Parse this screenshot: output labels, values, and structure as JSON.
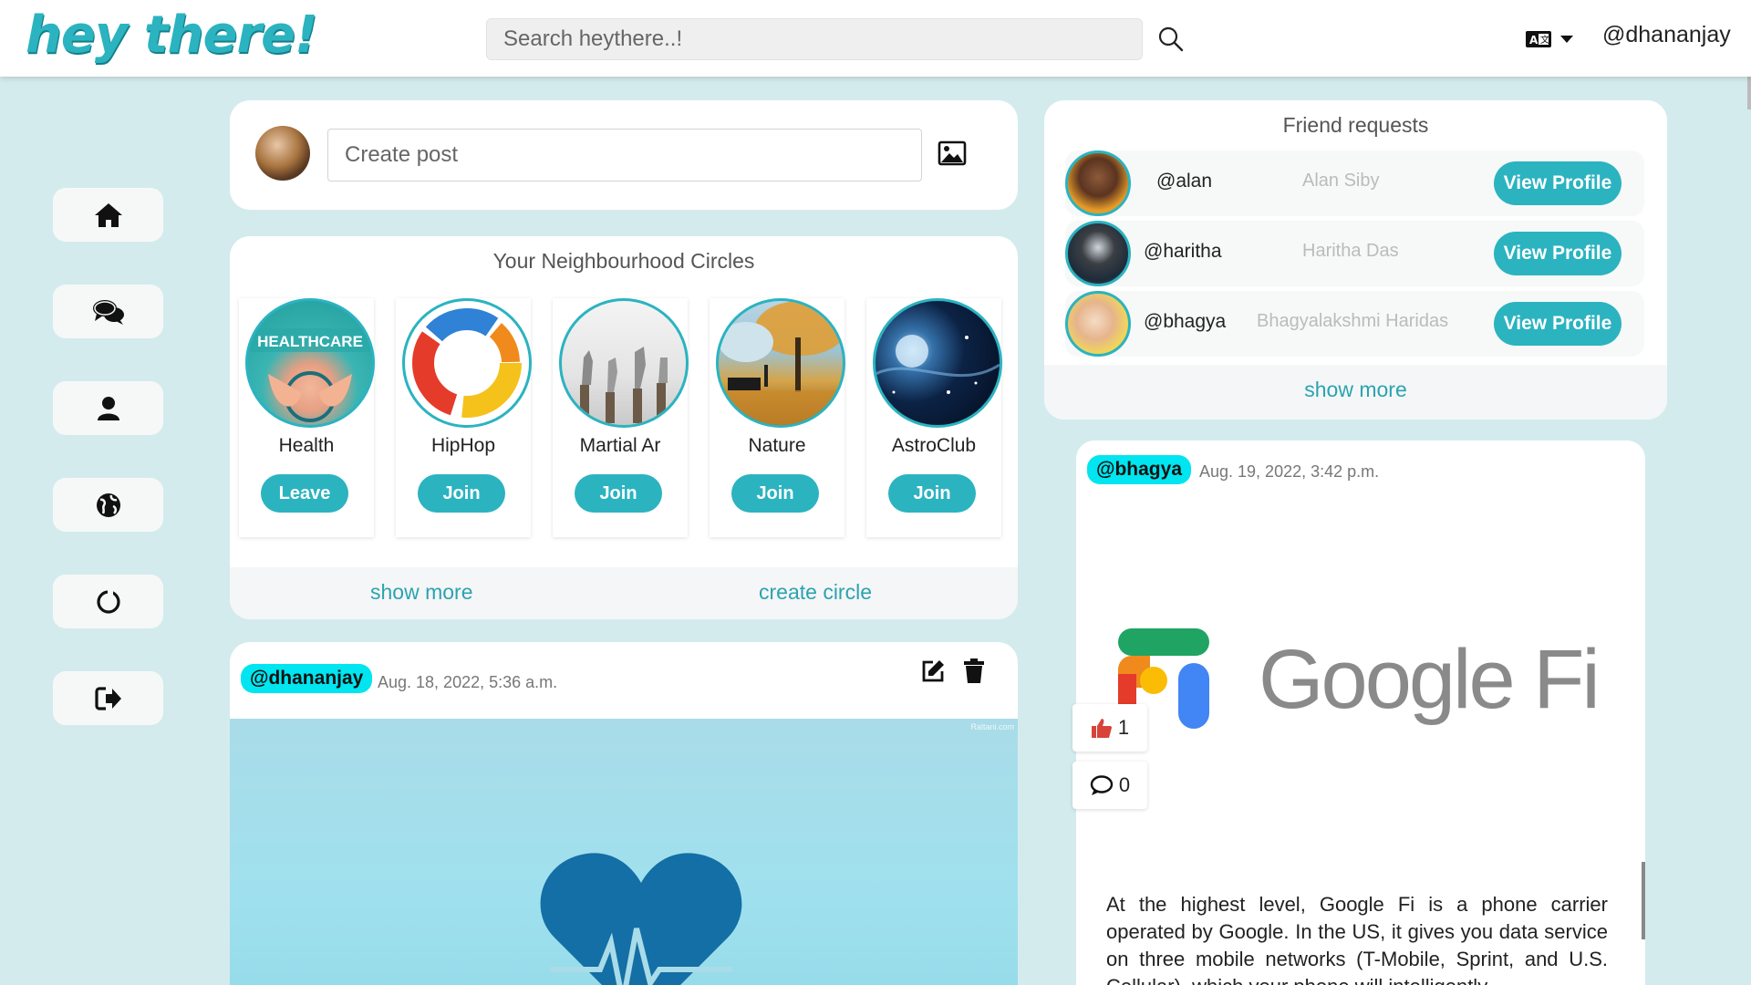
{
  "app": {
    "logo": "hey there!",
    "search_placeholder": "Search heythere..!",
    "username": "@dhananjay",
    "accent": "#2bb3c0"
  },
  "nav": {
    "items": [
      {
        "icon": "home-icon"
      },
      {
        "icon": "chat-icon"
      },
      {
        "icon": "profile-icon"
      },
      {
        "icon": "globe-icon"
      },
      {
        "icon": "circle-icon"
      },
      {
        "icon": "logout-icon"
      }
    ]
  },
  "create_post": {
    "placeholder": "Create post"
  },
  "circles": {
    "title": "Your Neighbourhood Circles",
    "items": [
      {
        "name": "Health",
        "action": "Leave",
        "image_text": "HEALTHCARE"
      },
      {
        "name": "HipHop",
        "action": "Join"
      },
      {
        "name": "Martial Ar",
        "action": "Join"
      },
      {
        "name": "Nature",
        "action": "Join"
      },
      {
        "name": "AstroClub",
        "action": "Join"
      }
    ],
    "show_more": "show more",
    "create_circle": "create circle"
  },
  "my_post": {
    "author": "@dhananjay",
    "date": "Aug. 18, 2022, 5:36 a.m.",
    "watermark": "Raltani.com"
  },
  "friend_requests": {
    "title": "Friend requests",
    "items": [
      {
        "handle": "@alan",
        "name": "Alan Siby",
        "action": "View Profile"
      },
      {
        "handle": "@haritha",
        "name": "Haritha Das",
        "action": "View Profile"
      },
      {
        "handle": "@bhagya",
        "name": "Bhagyalakshmi Haridas",
        "action": "View Profile"
      }
    ],
    "show_more": "show more"
  },
  "feed_post": {
    "author": "@bhagya",
    "date": "Aug. 19, 2022, 3:42 p.m.",
    "brand_text": "Google Fi",
    "likes": "1",
    "comments": "0",
    "body": "At the highest level, Google Fi is a phone carrier operated by Google. In the US, it gives you data service on three mobile networks (T-Mobile, Sprint, and U.S. Cellular), which your phone will intelligently"
  }
}
